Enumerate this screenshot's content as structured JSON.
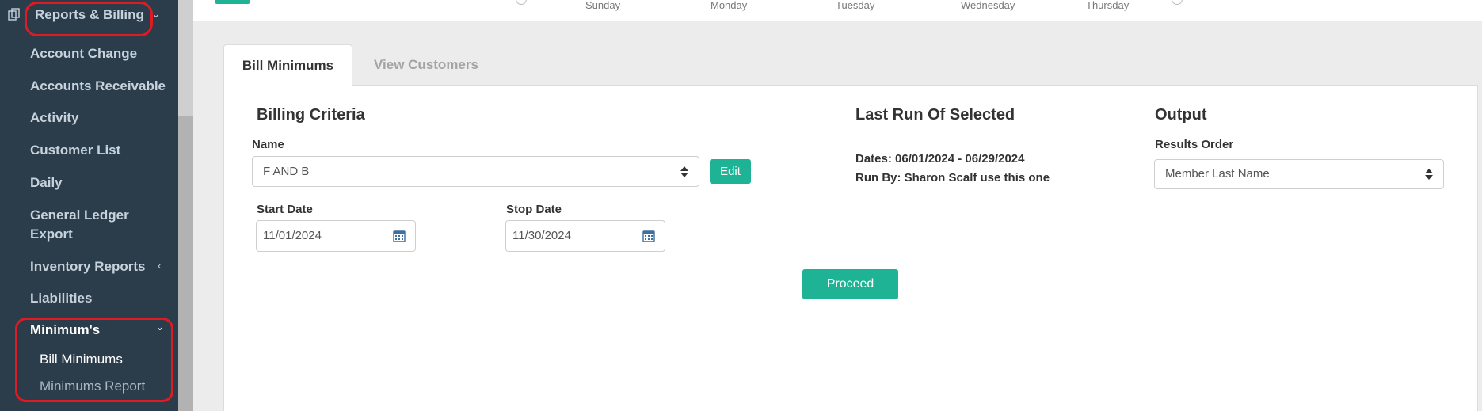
{
  "sidebar": {
    "section_title": "Reports & Billing",
    "items": [
      {
        "label": "Account Change"
      },
      {
        "label": "Accounts Receivable"
      },
      {
        "label": "Activity"
      },
      {
        "label": "Customer List"
      },
      {
        "label": "Daily"
      },
      {
        "label": "General Ledger",
        "label2": "Export"
      },
      {
        "label": "Inventory Reports"
      },
      {
        "label": "Liabilities"
      },
      {
        "label": "Minimum's"
      }
    ],
    "subitems": [
      {
        "label": "Bill Minimums"
      },
      {
        "label": "Minimums Report"
      }
    ]
  },
  "topbar": {
    "days": [
      "Sunday",
      "Monday",
      "Tuesday",
      "Wednesday",
      "Thursday"
    ]
  },
  "tabs": [
    {
      "label": "Bill Minimums"
    },
    {
      "label": "View Customers"
    }
  ],
  "billing_criteria": {
    "heading": "Billing Criteria",
    "name_label": "Name",
    "name_value": "F AND B",
    "edit_label": "Edit",
    "start_label": "Start Date",
    "start_value": "11/01/2024",
    "stop_label": "Stop Date",
    "stop_value": "11/30/2024",
    "proceed_label": "Proceed"
  },
  "last_run": {
    "heading": "Last Run Of Selected",
    "dates": "Dates: 06/01/2024 - 06/29/2024",
    "run_by": "Run By: Sharon Scalf use this one"
  },
  "output": {
    "heading": "Output",
    "results_label": "Results Order",
    "results_value": "Member Last Name"
  },
  "colors": {
    "sidebar_bg": "#2b3c4a",
    "accent": "#1db394",
    "highlight": "#e01a23"
  }
}
